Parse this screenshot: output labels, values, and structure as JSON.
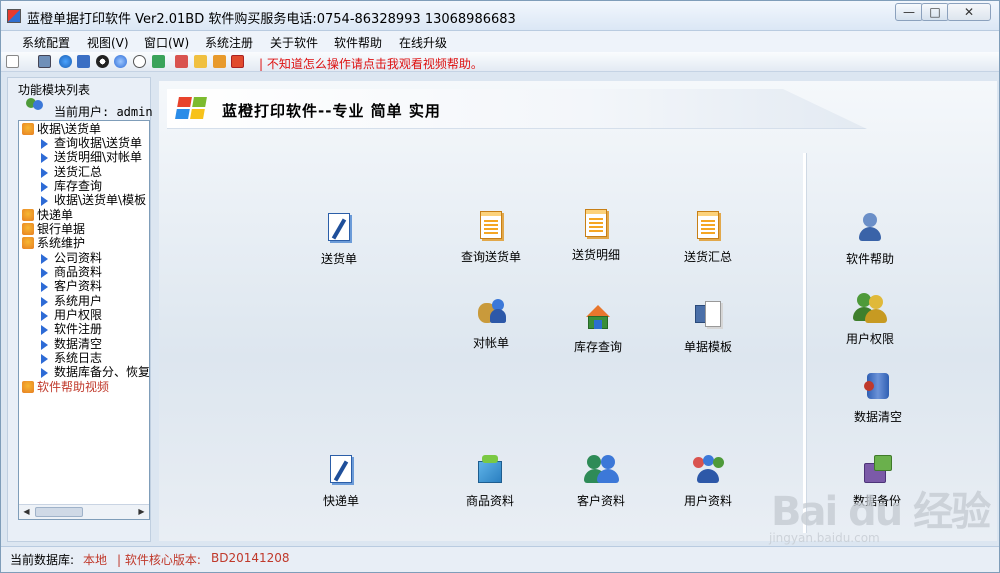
{
  "window": {
    "title": "蓝橙单据打印软件 Ver2.01BD  软件购买服务电话:0754-86328993 13068986683",
    "min": "—",
    "max": "□",
    "close": "✕"
  },
  "menu": [
    "系统配置",
    "视图(V)",
    "窗口(W)",
    "系统注册",
    "关于软件",
    "软件帮助",
    "在线升级"
  ],
  "toolbar": {
    "help_text": "| 不知道怎么操作请点击我观看视频帮助。",
    "icons": [
      "new-icon",
      "print-icon",
      "ie-icon",
      "book-icon",
      "qq-icon",
      "globe-icon",
      "help-icon",
      "tree-icon",
      "download-icon",
      "folder-icon",
      "arrow-down-icon",
      "close-red-icon"
    ]
  },
  "sidebar": {
    "title": "功能模块列表",
    "current_user": "当前用户: admin",
    "tree": [
      {
        "label": "收据\\送货单",
        "level": 0
      },
      {
        "label": "查询收据\\送货单",
        "level": 1
      },
      {
        "label": "送货明细\\对帐单",
        "level": 1
      },
      {
        "label": "送货汇总",
        "level": 1
      },
      {
        "label": "库存查询",
        "level": 1
      },
      {
        "label": "收据\\送货单\\模板",
        "level": 1
      },
      {
        "label": "快递单",
        "level": 0
      },
      {
        "label": "银行单据",
        "level": 0
      },
      {
        "label": "系统维护",
        "level": 0
      },
      {
        "label": "公司资料",
        "level": 1
      },
      {
        "label": "商品资料",
        "level": 1
      },
      {
        "label": "客户资料",
        "level": 1
      },
      {
        "label": "系统用户",
        "level": 1
      },
      {
        "label": "用户权限",
        "level": 1
      },
      {
        "label": "软件注册",
        "level": 1
      },
      {
        "label": "数据清空",
        "level": 1
      },
      {
        "label": "系统日志",
        "level": 1
      },
      {
        "label": "数据库备分、恢复",
        "level": 1
      },
      {
        "label": "软件帮助视频",
        "level": 0,
        "highlight": true
      }
    ]
  },
  "main": {
    "banner": "蓝橙打印软件--专业 简单 实用",
    "tiles": {
      "delivery": "送货单",
      "query_delivery": "查询送货单",
      "delivery_detail": "送货明细",
      "delivery_summary": "送货汇总",
      "statement": "对帐单",
      "stock_query": "库存查询",
      "templates": "单据模板",
      "express": "快递单",
      "products": "商品资料",
      "customers": "客户资料",
      "users": "用户资料",
      "help": "软件帮助",
      "permissions": "用户权限",
      "clear_data": "数据清空",
      "backup": "数据备份"
    }
  },
  "status": {
    "db_label": "当前数据库:",
    "db_value": "本地",
    "version_label": "| 软件核心版本:",
    "version_value": "BD20141208"
  },
  "watermark": {
    "text": "Bai du 经验",
    "url": "jingyan.baidu.com"
  },
  "colors": {
    "accent_red": "#c0392b",
    "tree_arrow": "#2d6bd6"
  }
}
